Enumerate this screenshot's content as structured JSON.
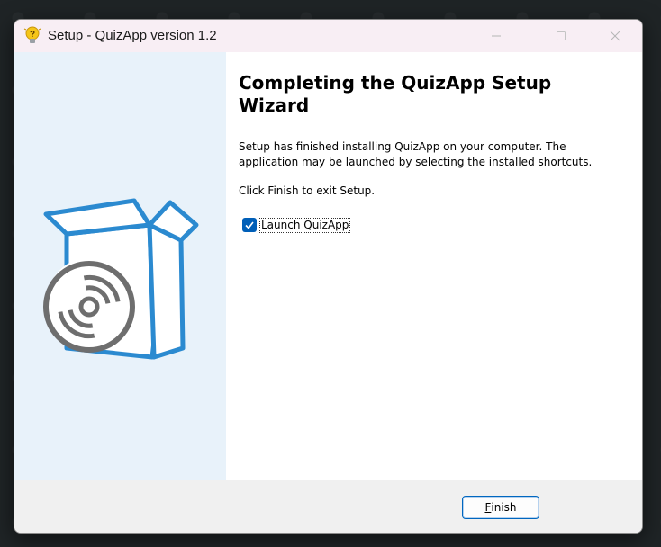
{
  "window": {
    "title": "Setup - QuizApp version 1.2",
    "controls": [
      "minimize",
      "maximize",
      "close"
    ]
  },
  "content": {
    "heading": "Completing the QuizApp Setup Wizard",
    "paragraph1": "Setup has finished installing QuizApp on your computer. The application may be launched by selecting the installed shortcuts.",
    "paragraph2": "Click Finish to exit Setup.",
    "launch_checkbox": {
      "label": "Launch QuizApp",
      "checked": true
    }
  },
  "footer": {
    "finish_button": {
      "mnemonic": "F",
      "rest": "inish"
    }
  },
  "icons": {
    "app": "lightbulb-question-icon",
    "illustration": "box-with-disc-icon",
    "checkmark": "checkmark-icon"
  },
  "colors": {
    "accent": "#005fb8",
    "illustration_blue": "#2b8ad0",
    "disc_gray": "#6e6e6e",
    "side_panel": "#e8f2fa",
    "titlebar": "#f8eef4"
  }
}
